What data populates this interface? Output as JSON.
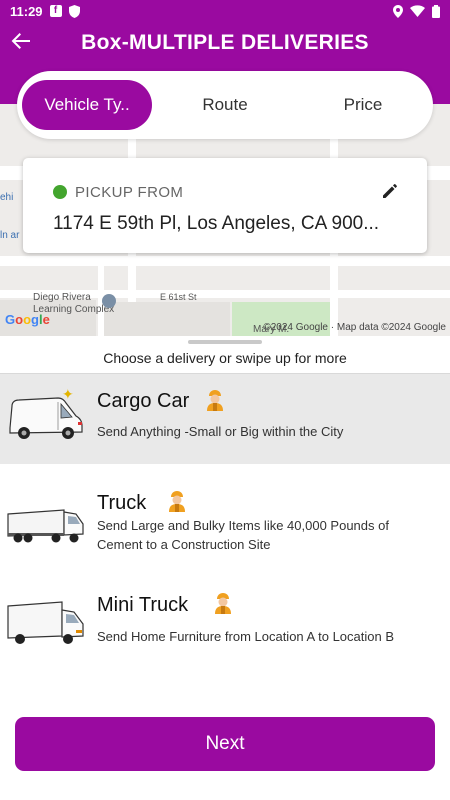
{
  "status_bar": {
    "time": "11:29",
    "icons_left": [
      "facebook-icon",
      "shield-icon"
    ],
    "icons_right": [
      "location-icon",
      "wifi-icon",
      "battery-icon"
    ]
  },
  "header": {
    "title": "Box-MULTIPLE DELIVERIES",
    "background": "#9a0aa0"
  },
  "tabs": [
    {
      "label": "Vehicle Ty..",
      "active": true
    },
    {
      "label": "Route",
      "active": false
    },
    {
      "label": "Price",
      "active": false
    }
  ],
  "map": {
    "labels": {
      "poi": "Diego Rivera\nLearning Complex",
      "street": "E 61st St",
      "street2": "Mary M.",
      "left1": "ehi",
      "left2": "ln ar"
    },
    "attribution": "©2024 Google · Map data ©2024 Google",
    "logo": "Google"
  },
  "pickup": {
    "label": "PICKUP FROM",
    "address": "1174 E 59th Pl, Los Angeles, CA 900...",
    "dot_color": "#43a52e"
  },
  "sheet": {
    "hint": "Choose a delivery or swipe up for more"
  },
  "vehicles": [
    {
      "name": "Cargo Car",
      "description": "Send Anything -Small or Big within the City",
      "selected": true,
      "icon": "cargo-van-icon"
    },
    {
      "name": "Truck",
      "description": "Send Large and Bulky Items like 40,000 Pounds of Cement to a Construction Site",
      "selected": false,
      "icon": "truck-icon"
    },
    {
      "name": "Mini Truck",
      "description": "Send Home Furniture from Location A to Location B",
      "selected": false,
      "icon": "mini-truck-icon"
    }
  ],
  "footer": {
    "next_label": "Next"
  }
}
